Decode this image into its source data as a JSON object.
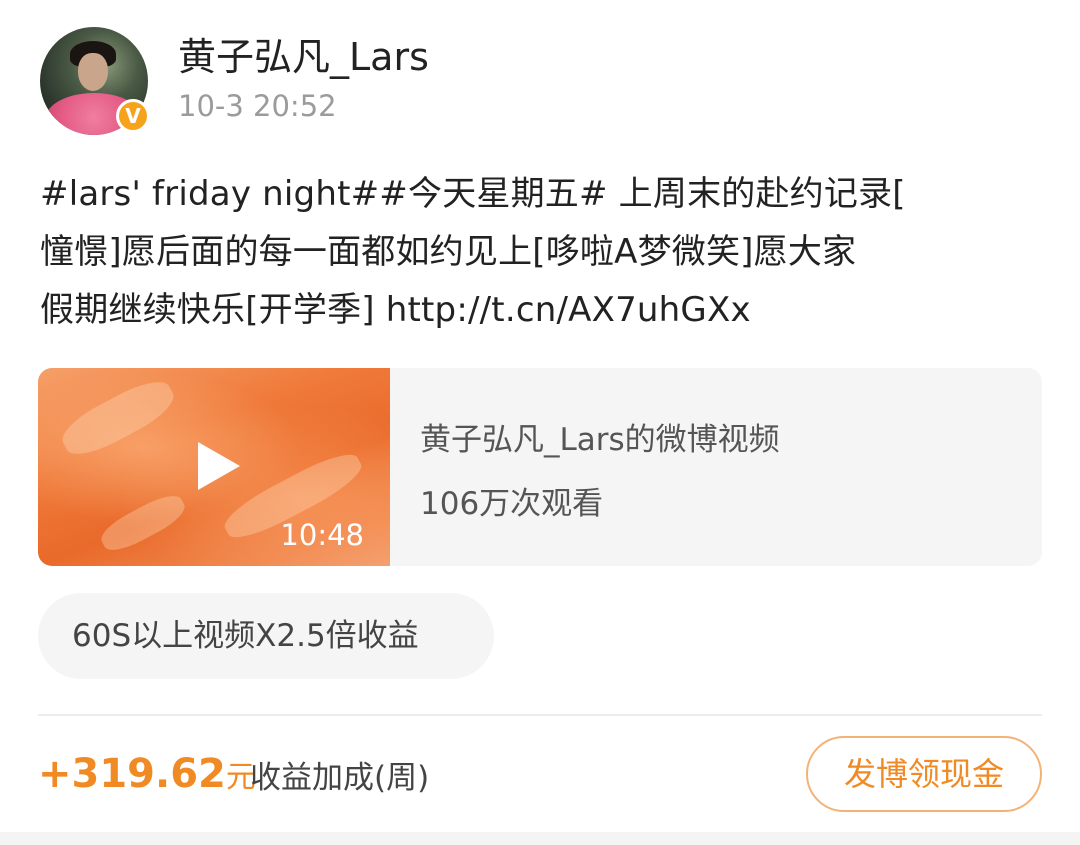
{
  "post": {
    "author": "黄子弘凡_Lars",
    "timestamp": "10-3 20:52",
    "verified_badge": "V",
    "text_line1": "#lars' friday night##今天星期五# 上周末的赴约记录[",
    "text_line2": "憧憬]愿后面的每一面都如约见上[哆啦A梦微笑]愿大家",
    "text_line3": "假期继续快乐[开学季] http://t.cn/AX7uhGXx"
  },
  "video": {
    "title": "黄子弘凡_Lars的微博视频",
    "views": "106万次观看",
    "duration": "10:48"
  },
  "bonus_tag": "60S以上视频X2.5倍收益",
  "footer": {
    "amount": "+319.62",
    "unit": "元",
    "label": "收益加成(周)",
    "button": "发博领现金"
  },
  "colors": {
    "accent": "#f08a24",
    "badge": "#f7a21b"
  },
  "icons": {
    "play": "play-icon",
    "verified": "verified-badge-icon"
  }
}
